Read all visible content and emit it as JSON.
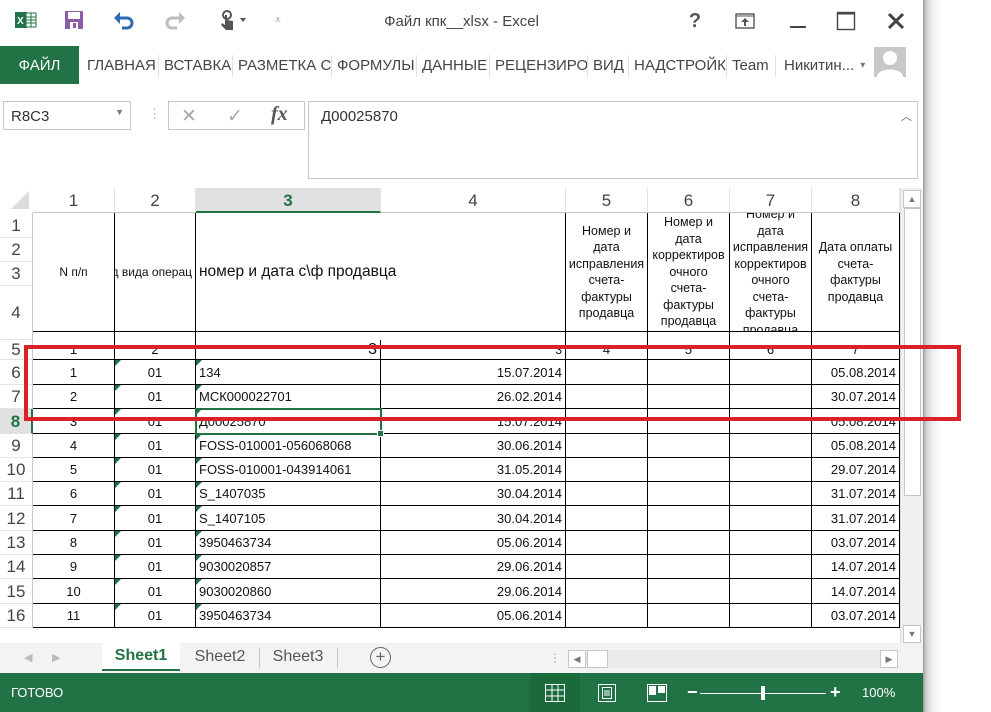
{
  "titlebar": {
    "title": "Файл кпк__xlsx - Excel",
    "icons": [
      "excel-logo-icon",
      "save-icon",
      "undo-icon",
      "redo-icon",
      "touch-mode-icon",
      "customize-qat-icon"
    ],
    "window_buttons": {
      "help": "?",
      "ribbon_display": "ribbon-display-icon",
      "minimize": "minimize-icon",
      "maximize": "maximize-icon",
      "close": "close-icon"
    }
  },
  "ribbon": {
    "file_tab": "ФАЙЛ",
    "tabs": [
      "ГЛАВНАЯ",
      "ВСТАВКА",
      "РАЗМЕТКА С",
      "ФОРМУЛЫ",
      "ДАННЫЕ",
      "РЕЦЕНЗИРО",
      "ВИД",
      "НАДСТРОЙК",
      "Team"
    ],
    "user_name": "Никитин...",
    "user_dropdown": "▾"
  },
  "formula_bar": {
    "name_box": "R8C3",
    "cancel_glyph": "✕",
    "enter_glyph": "✓",
    "fx_label": "fx",
    "value": "Д00025870"
  },
  "grid": {
    "column_headers": [
      "1",
      "2",
      "3",
      "4",
      "5",
      "6",
      "7",
      "8"
    ],
    "selected_column": "3",
    "row_headers": [
      "1",
      "2",
      "3",
      "4",
      "5",
      "6",
      "7",
      "8",
      "9",
      "10",
      "11",
      "12",
      "13",
      "14",
      "15",
      "16"
    ],
    "selected_row": "8",
    "active_cell": "R8C3",
    "header_cells": [
      "N п/п",
      "Код вида операции",
      "номер и дата с\\ф продавца",
      "",
      "Номер и дата исправления счета-фактуры продавца",
      "Номер и дата корректировочного счета-фактуры продавца",
      "Номер и дата исправления корректировочного счета-фактуры продавца",
      "Дата оплаты счета-фактуры продавца"
    ],
    "header_cells_visible": [
      "N п/п",
      "д вида операц",
      "номер и дата с\\ф продавца",
      "",
      "Номер и дата исправления счета-фактуры продавца",
      "Номер и дата корректиров очного счета-фактуры продавца",
      "Номер и дата исправления корректиров очного счета-фактуры продавца",
      "Дата оплаты счета-фактуры продавца"
    ],
    "numbering_row": [
      "1",
      "2",
      "3",
      "3",
      "4",
      "5",
      "6",
      "7"
    ],
    "rows": [
      {
        "row": "6",
        "n": "1",
        "code": "01",
        "invoice": "134",
        "date": "15.07.2014",
        "c5": "",
        "c6": "",
        "c7": "",
        "pay_date": "05.08.2014"
      },
      {
        "row": "7",
        "n": "2",
        "code": "01",
        "invoice": "МСК000022701",
        "date": "26.02.2014",
        "c5": "",
        "c6": "",
        "c7": "",
        "pay_date": "30.07.2014"
      },
      {
        "row": "8",
        "n": "3",
        "code": "01",
        "invoice": "Д00025870",
        "date": "15.07.2014",
        "c5": "",
        "c6": "",
        "c7": "",
        "pay_date": "05.08.2014"
      },
      {
        "row": "9",
        "n": "4",
        "code": "01",
        "invoice": "FOSS-010001-056068068",
        "date": "30.06.2014",
        "c5": "",
        "c6": "",
        "c7": "",
        "pay_date": "05.08.2014"
      },
      {
        "row": "10",
        "n": "5",
        "code": "01",
        "invoice": "FOSS-010001-043914061",
        "date": "31.05.2014",
        "c5": "",
        "c6": "",
        "c7": "",
        "pay_date": "29.07.2014"
      },
      {
        "row": "11",
        "n": "6",
        "code": "01",
        "invoice": "S_1407035",
        "date": "30.04.2014",
        "c5": "",
        "c6": "",
        "c7": "",
        "pay_date": "31.07.2014"
      },
      {
        "row": "12",
        "n": "7",
        "code": "01",
        "invoice": "S_1407105",
        "date": "30.04.2014",
        "c5": "",
        "c6": "",
        "c7": "",
        "pay_date": "31.07.2014"
      },
      {
        "row": "13",
        "n": "8",
        "code": "01",
        "invoice": "3950463734",
        "date": "05.06.2014",
        "c5": "",
        "c6": "",
        "c7": "",
        "pay_date": "03.07.2014"
      },
      {
        "row": "14",
        "n": "9",
        "code": "01",
        "invoice": "9030020857",
        "date": "29.06.2014",
        "c5": "",
        "c6": "",
        "c7": "",
        "pay_date": "14.07.2014"
      },
      {
        "row": "15",
        "n": "10",
        "code": "01",
        "invoice": "9030020860",
        "date": "29.06.2014",
        "c5": "",
        "c6": "",
        "c7": "",
        "pay_date": "14.07.2014"
      },
      {
        "row": "16",
        "n": "11",
        "code": "01",
        "invoice": "3950463734",
        "date": "05.06.2014",
        "c5": "",
        "c6": "",
        "c7": "",
        "pay_date": "03.07.2014"
      }
    ],
    "highlight_color": "#d9222a"
  },
  "sheets": {
    "tabs": [
      "Sheet1",
      "Sheet2",
      "Sheet3"
    ],
    "active": "Sheet1",
    "add_label": "+"
  },
  "statusbar": {
    "status": "ГОТОВО",
    "zoom_percent": "100%",
    "zoom_value": 100,
    "active_view": "normal"
  },
  "colors": {
    "accent": "#217346",
    "highlight": "#d9222a"
  }
}
